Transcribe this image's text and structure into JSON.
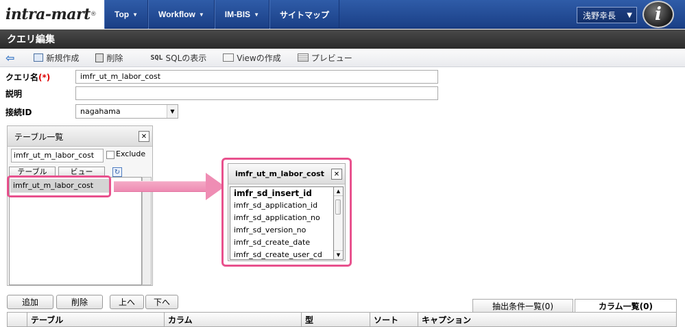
{
  "header": {
    "logo_text": "intra-mart",
    "nav": [
      {
        "label": "Top"
      },
      {
        "label": "Workflow"
      },
      {
        "label": "IM-BIS"
      },
      {
        "label": "サイトマップ"
      }
    ],
    "user_name": "浅野幸長"
  },
  "page_title": "クエリ編集",
  "toolbar": {
    "new": "新規作成",
    "delete": "削除",
    "sql_icon": "SQL",
    "sql_show": "SQLの表示",
    "view_create": "Viewの作成",
    "preview": "プレビュー"
  },
  "form": {
    "query_name_label": "クエリ名",
    "required_mark": "(*)",
    "query_name_value": "imfr_ut_m_labor_cost",
    "description_label": "説明",
    "description_value": "",
    "connection_label": "接続ID",
    "connection_value": "nagahama"
  },
  "table_panel": {
    "title": "テーブル一覧",
    "filter_value": "imfr_ut_m_labor_cost",
    "exclude_label": "Exclude",
    "tab_table": "テーブル",
    "tab_view": "ビュー",
    "items": [
      "imfr_ut_m_labor_cost"
    ]
  },
  "column_popup": {
    "title": "imfr_ut_m_labor_cost",
    "columns": [
      "imfr_sd_insert_id",
      "imfr_sd_application_id",
      "imfr_sd_application_no",
      "imfr_sd_version_no",
      "imfr_sd_create_date",
      "imfr_sd_create_user_cd"
    ]
  },
  "bottom": {
    "add": "追加",
    "delete": "削除",
    "up": "上へ",
    "down": "下へ",
    "tab_conditions": "抽出条件一覧(0)",
    "tab_columns": "カラム一覧(0)",
    "columns": [
      "テーブル",
      "カラム",
      "型",
      "ソート",
      "キャプション"
    ]
  },
  "colors": {
    "header_blue": "#1a3f86",
    "highlight_pink": "#e8518d",
    "required_red": "#dd0000"
  }
}
